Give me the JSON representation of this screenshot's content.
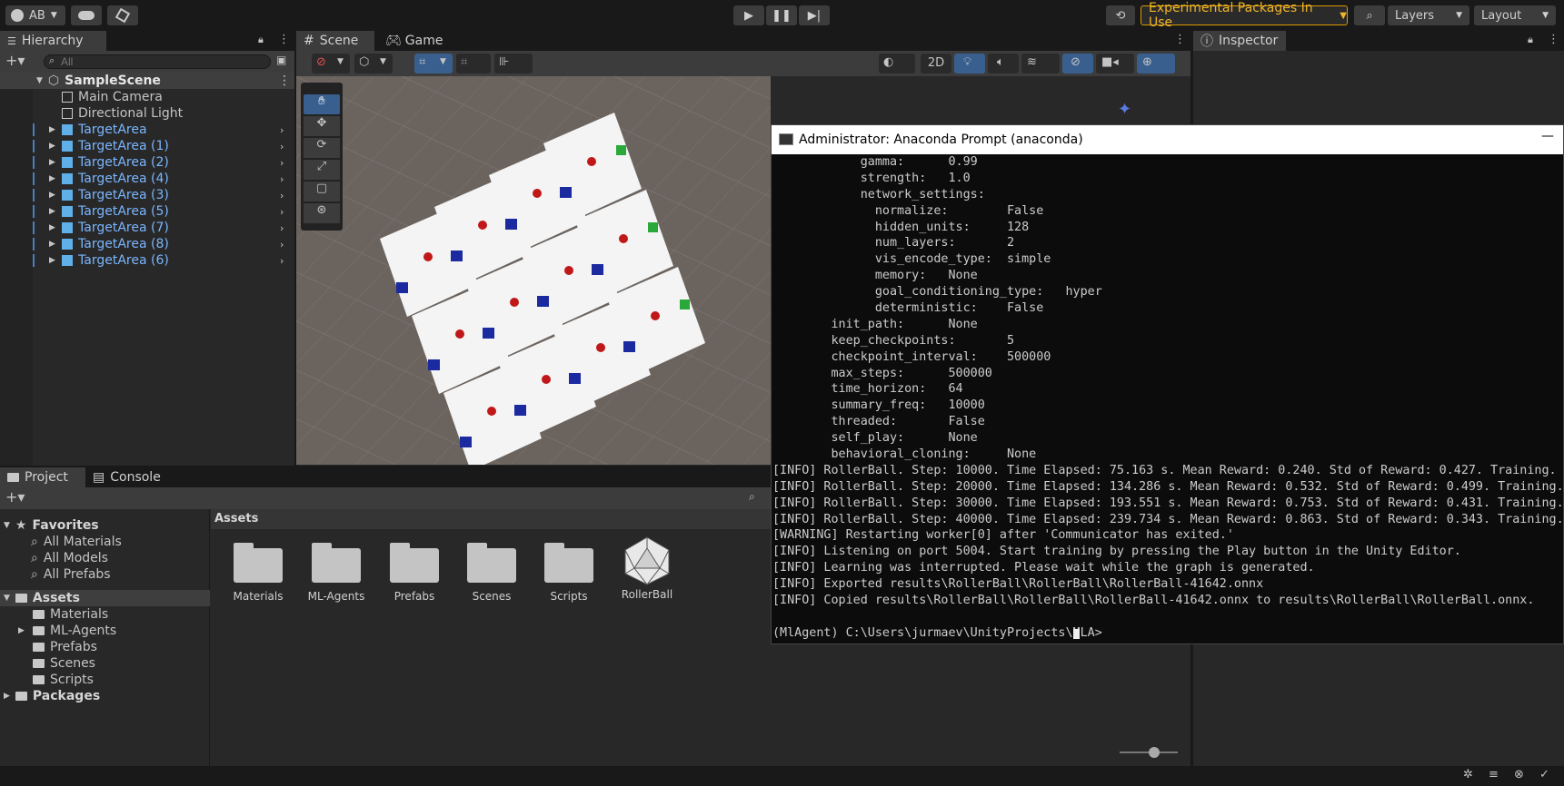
{
  "toolbar": {
    "account": "AB",
    "experimental": "Experimental Packages In Use",
    "layers": "Layers",
    "layout": "Layout"
  },
  "hierarchy": {
    "title": "Hierarchy",
    "search_placeholder": "All",
    "scene": "SampleScene",
    "items": [
      "Main Camera",
      "Directional Light",
      "TargetArea",
      "TargetArea (1)",
      "TargetArea (2)",
      "TargetArea (4)",
      "TargetArea (3)",
      "TargetArea (5)",
      "TargetArea (7)",
      "TargetArea (8)",
      "TargetArea (6)"
    ]
  },
  "scene_tabs": {
    "scene": "Scene",
    "game": "Game",
    "mode2d": "2D"
  },
  "inspector": {
    "title": "Inspector"
  },
  "project": {
    "tab_project": "Project",
    "tab_console": "Console",
    "favorites": "Favorites",
    "fav_items": [
      "All Materials",
      "All Models",
      "All Prefabs"
    ],
    "assets_root": "Assets",
    "asset_tree": [
      "Materials",
      "ML-Agents",
      "Prefabs",
      "Scenes",
      "Scripts"
    ],
    "packages": "Packages",
    "breadcrumb": "Assets",
    "grid": [
      "Materials",
      "ML-Agents",
      "Prefabs",
      "Scenes",
      "Scripts",
      "RollerBall"
    ]
  },
  "terminal": {
    "title": "Administrator: Anaconda Prompt (anaconda)",
    "lines": [
      "            gamma:      0.99",
      "            strength:   1.0",
      "            network_settings:",
      "              normalize:        False",
      "              hidden_units:     128",
      "              num_layers:       2",
      "              vis_encode_type:  simple",
      "              memory:   None",
      "              goal_conditioning_type:   hyper",
      "              deterministic:    False",
      "        init_path:      None",
      "        keep_checkpoints:       5",
      "        checkpoint_interval:    500000",
      "        max_steps:      500000",
      "        time_horizon:   64",
      "        summary_freq:   10000",
      "        threaded:       False",
      "        self_play:      None",
      "        behavioral_cloning:     None",
      "[INFO] RollerBall. Step: 10000. Time Elapsed: 75.163 s. Mean Reward: 0.240. Std of Reward: 0.427. Training.",
      "[INFO] RollerBall. Step: 20000. Time Elapsed: 134.286 s. Mean Reward: 0.532. Std of Reward: 0.499. Training.",
      "[INFO] RollerBall. Step: 30000. Time Elapsed: 193.551 s. Mean Reward: 0.753. Std of Reward: 0.431. Training.",
      "[INFO] RollerBall. Step: 40000. Time Elapsed: 239.734 s. Mean Reward: 0.863. Std of Reward: 0.343. Training.",
      "[WARNING] Restarting worker[0] after 'Communicator has exited.'",
      "[INFO] Listening on port 5004. Start training by pressing the Play button in the Unity Editor.",
      "[INFO] Learning was interrupted. Please wait while the graph is generated.",
      "[INFO] Exported results\\RollerBall\\RollerBall\\RollerBall-41642.onnx",
      "[INFO] Copied results\\RollerBall\\RollerBall\\RollerBall-41642.onnx to results\\RollerBall\\RollerBall.onnx.",
      "",
      "(MlAgent) C:\\Users\\jurmaev\\UnityProjects\\MLA>"
    ]
  },
  "colors": {
    "accent_blue": "#7ab6ff",
    "warning": "#f0b428",
    "selection": "#2c5d87"
  }
}
